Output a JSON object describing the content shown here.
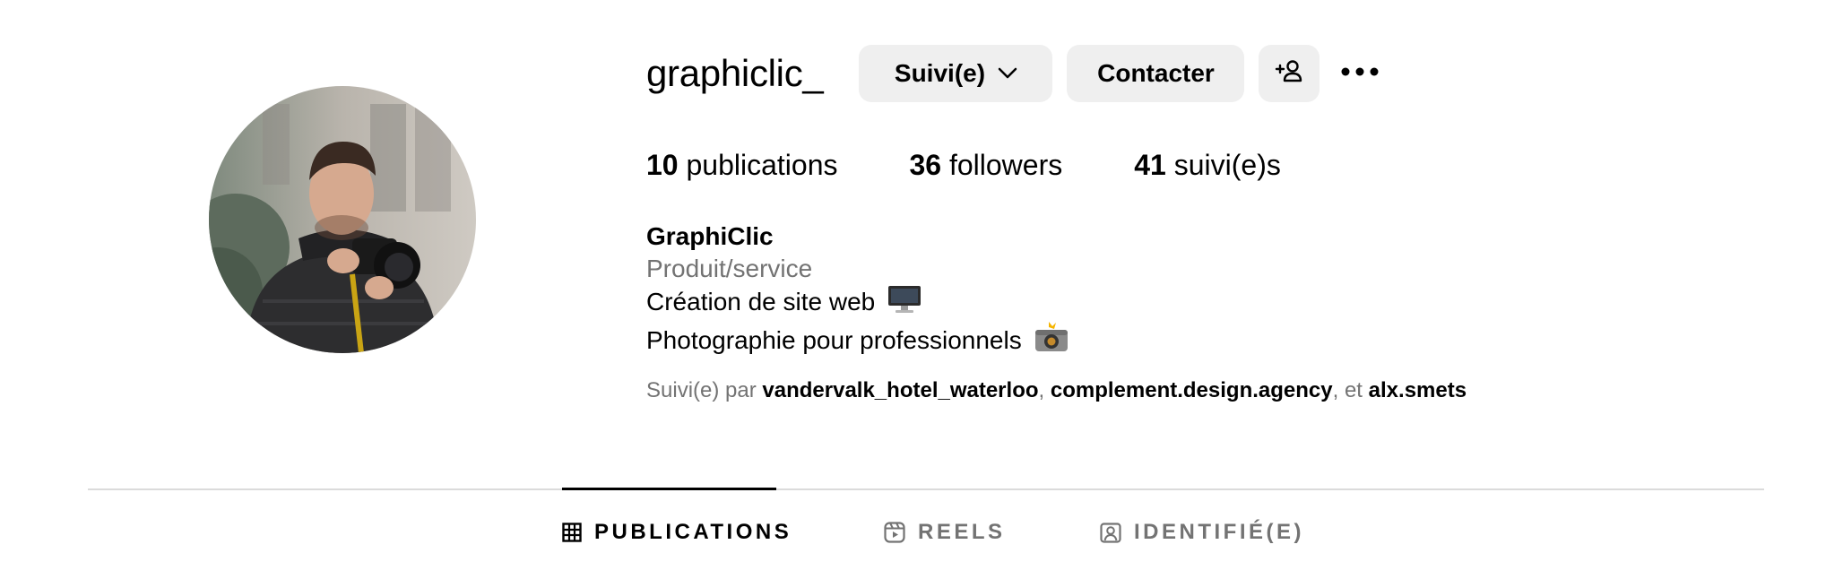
{
  "profile": {
    "username": "graphiclic_",
    "follow_button": "Suivi(e)",
    "contact_button": "Contacter",
    "add_user_icon": "add-user-icon",
    "more_icon": "more-horizontal-icon"
  },
  "stats": {
    "publications_count": "10",
    "publications_label": "publications",
    "followers_count": "36",
    "followers_label": "followers",
    "following_count": "41",
    "following_label": "suivi(e)s"
  },
  "bio": {
    "name": "GraphiClic",
    "category": "Produit/service",
    "line1": "Création de site web",
    "line1_icon": "desktop-computer-emoji",
    "line2": "Photographie pour professionnels",
    "line2_icon": "camera-flash-emoji"
  },
  "followed_by": {
    "prefix": "Suivi(e) par",
    "accounts": [
      "vandervalk_hotel_waterloo",
      "complement.design.agency",
      "alx.smets"
    ],
    "separator": ",",
    "conjunction": ", et"
  },
  "tabs": [
    {
      "label": "PUBLICATIONS",
      "icon": "grid-icon",
      "active": true
    },
    {
      "label": "REELS",
      "icon": "reels-icon",
      "active": false
    },
    {
      "label": "IDENTIFIÉ(E)",
      "icon": "tagged-user-icon",
      "active": false
    }
  ],
  "colors": {
    "button_bg": "#efefef",
    "secondary_text": "#737373",
    "divider": "#dbdbdb"
  }
}
